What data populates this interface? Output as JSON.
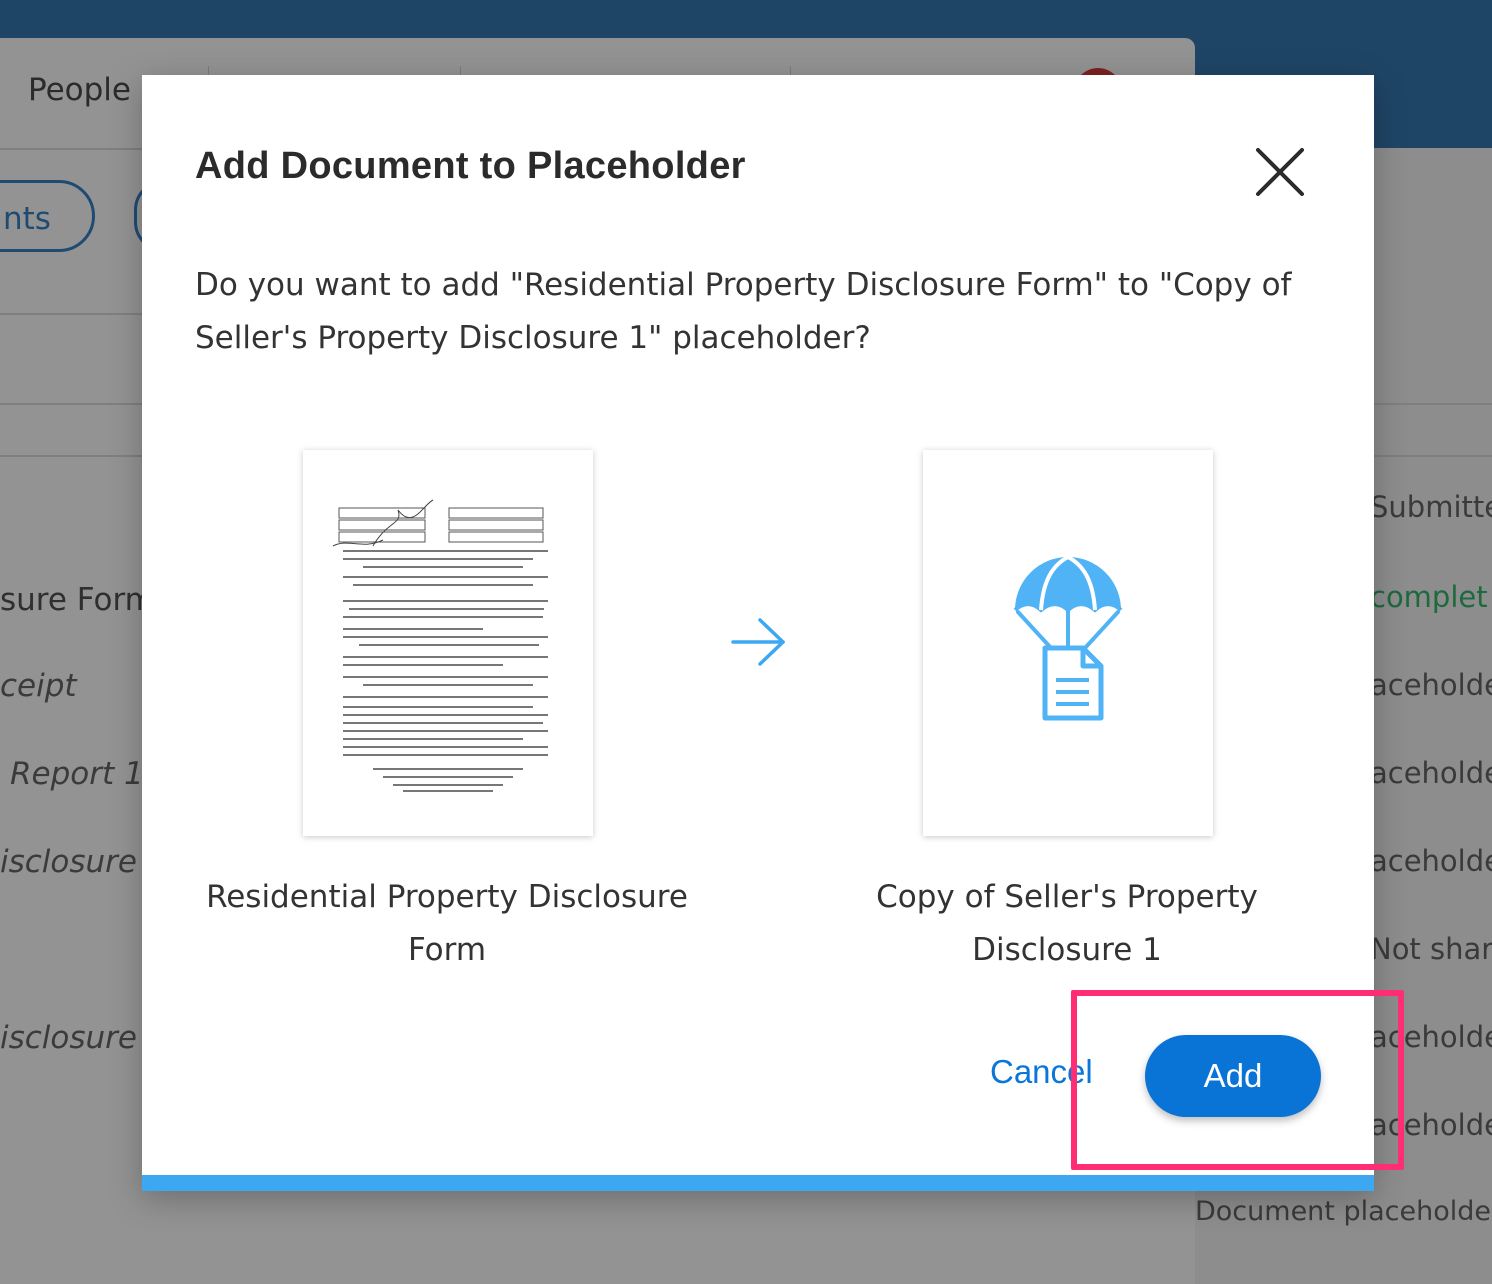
{
  "background": {
    "tab_people": "People",
    "pill_label": "nts",
    "left_rows": [
      {
        "text": "sure Form",
        "italic": false
      },
      {
        "text": "ceipt",
        "italic": true
      },
      {
        "text": "Report 1",
        "italic": true
      },
      {
        "text": "isclosure",
        "italic": true
      },
      {
        "text": "isclosure",
        "italic": true
      }
    ],
    "right_rows": [
      "Submitte",
      "complet",
      "aceholde",
      "aceholde",
      "aceholde",
      "Not share",
      "aceholde",
      "aceholde"
    ],
    "bottom_right": "Document placeholde"
  },
  "modal": {
    "title": "Add Document to Placeholder",
    "prompt": "Do you want to add \"Residential Property Disclosure Form\" to \"Copy of Seller's Property Disclosure 1\" placeholder?",
    "source_caption": "Residential Property Disclosure Form",
    "target_caption": "Copy of Seller's Property Disclosure 1",
    "cancel_label": "Cancel",
    "add_label": "Add",
    "icons": {
      "close": "close-icon",
      "arrow": "arrow-right-icon",
      "placeholder": "parachute-document-icon"
    },
    "colors": {
      "primary": "#0a73d6",
      "link": "#0a76d8",
      "accent_bar": "#3ea7f2",
      "highlight": "#ff2d73",
      "icon_blue": "#4fb3f6"
    }
  }
}
